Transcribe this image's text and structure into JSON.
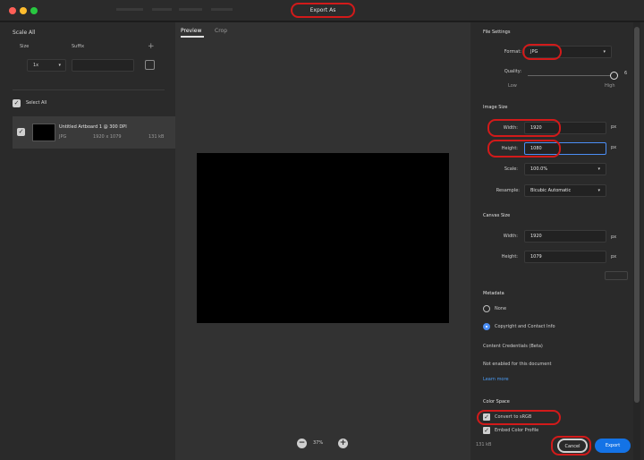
{
  "window": {
    "title": "Export As"
  },
  "left": {
    "scale_all": "Scale All",
    "size_header": "Size",
    "suffix_header": "Suffix",
    "plus": "+",
    "scale_value": "1x",
    "select_all": "Select All",
    "asset": {
      "name": "Untitled Artboard 1 @ 300 DPI",
      "format": "JPG",
      "dimensions": "1920 x 1079",
      "filesize": "131 kB"
    }
  },
  "center": {
    "tabs": [
      "Preview",
      "Crop"
    ],
    "zoom_level": "37%",
    "zoom_out": "−",
    "zoom_in": "+"
  },
  "right": {
    "file_settings": "File Settings",
    "format_label": "Format:",
    "format_value": "JPG",
    "quality_label": "Quality:",
    "quality_value": "6",
    "quality_low": "Low",
    "quality_high": "High",
    "image_size": "Image Size",
    "width_label": "Width:",
    "width_value": "1920",
    "height_label": "Height:",
    "height_value": "1080",
    "scale_label": "Scale:",
    "scale_value": "100.0%",
    "resample_label": "Resample:",
    "resample_value": "Bicubic Automatic",
    "canvas_size": "Canvas Size",
    "canvas_width_label": "Width:",
    "canvas_width_value": "1920",
    "canvas_height_label": "Height:",
    "canvas_height_value": "1079",
    "unit_px": "px",
    "metadata": "Metadata",
    "meta_none": "None",
    "meta_copyright": "Copyright and Contact Info",
    "content_credentials": "Content Credentials (Beta)",
    "cc_not_enabled": "Not enabled for this document",
    "cc_learn_more": "Learn more",
    "color_space": "Color Space",
    "convert_srgb": "Convert to sRGB",
    "embed_profile": "Embed Color Profile",
    "footer_size": "131 kB",
    "cancel": "Cancel",
    "export": "Export"
  },
  "colors": {
    "accent_blue": "#1473e6",
    "annotation_red": "#d21a1a",
    "panel_bg": "#2a2a2a",
    "preview_bg": "#323232"
  },
  "icons": [
    "close-window-icon",
    "minimize-window-icon",
    "zoom-window-icon",
    "plus-icon",
    "chevron-down-icon",
    "trash-icon",
    "checkbox-checked-icon",
    "zoom-out-icon",
    "zoom-in-icon",
    "radio-unchecked-icon",
    "radio-checked-icon"
  ]
}
